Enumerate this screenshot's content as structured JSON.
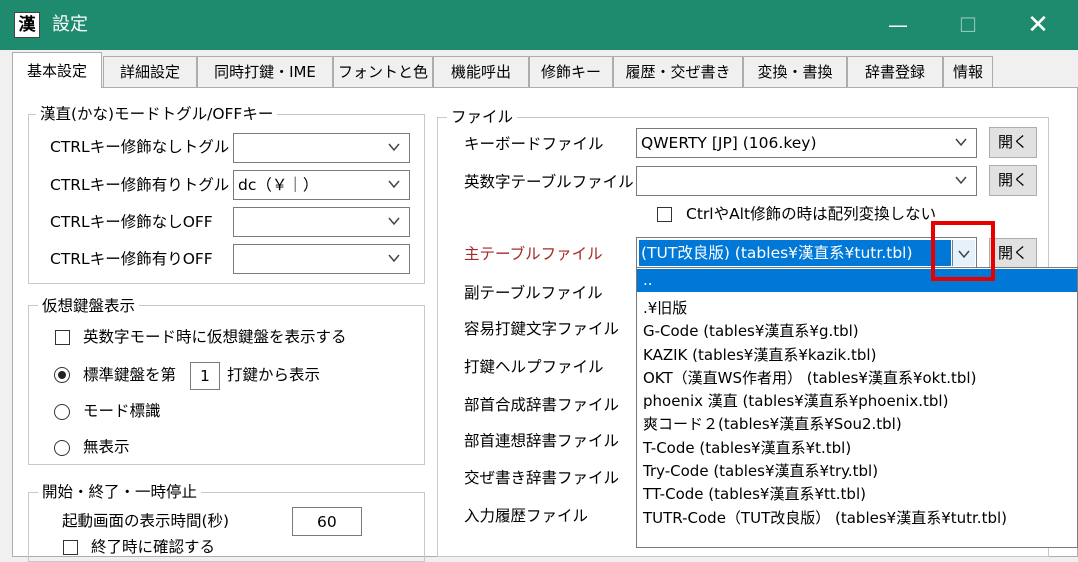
{
  "window": {
    "title": "設定",
    "icon_glyph": "漢",
    "min_glyph": "—",
    "max_glyph": "☐",
    "close_glyph": "✕"
  },
  "tabs": [
    "基本設定",
    "詳細設定",
    "同時打鍵・IME",
    "フォントと色",
    "機能呼出",
    "修飾キー",
    "履歴・交ぜ書き",
    "変換・書換",
    "辞書登録",
    "情報"
  ],
  "active_tab": 0,
  "toggle_group": {
    "legend": "漢直(かな)モードトグル/OFFキー",
    "rows": [
      {
        "label": "CTRLキー修飾なしトグル",
        "value": ""
      },
      {
        "label": "CTRLキー修飾有りトグル",
        "value": "dc（￥｜）"
      },
      {
        "label": "CTRLキー修飾なしOFF",
        "value": ""
      },
      {
        "label": "CTRLキー修飾有りOFF",
        "value": ""
      }
    ]
  },
  "vkb_group": {
    "legend": "仮想鍵盤表示",
    "checkbox_label": "英数字モード時に仮想鍵盤を表示する",
    "radio_standard_prefix": "標準鍵盤を第",
    "radio_standard_value": "1",
    "radio_standard_suffix": "打鍵から表示",
    "radio_mode": "モード標識",
    "radio_none": "無表示"
  },
  "start_group": {
    "legend": "開始・終了・一時停止",
    "splash_label": "起動画面の表示時間(秒)",
    "splash_value": "60",
    "confirm_label": "終了時に確認する"
  },
  "file_group": {
    "legend": "ファイル",
    "keyboard_label": "キーボードファイル",
    "keyboard_value": "QWERTY [JP] (106.key)",
    "alnum_label": "英数字テーブルファイル",
    "alnum_value": "",
    "ctrl_alt_label": "CtrlやAlt修飾の時は配列変換しない",
    "main_table_label": "主テーブルファイル",
    "main_table_value": "(TUT改良版) (tables¥漢直系¥tutr.tbl)",
    "sub_table_label": "副テーブルファイル",
    "easy_label": "容易打鍵文字ファイル",
    "help_label": "打鍵ヘルプファイル",
    "bushu_comp_label": "部首合成辞書ファイル",
    "bushu_assoc_label": "部首連想辞書ファイル",
    "mazegaki_label": "交ぜ書き辞書ファイル",
    "history_label": "入力履歴ファイル",
    "open_label": "開く"
  },
  "dropdown_items": [
    "..",
    ".¥旧版",
    "G-Code (tables¥漢直系¥g.tbl)",
    "KAZIK (tables¥漢直系¥kazik.tbl)",
    "OKT（漢直WS作者用） (tables¥漢直系¥okt.tbl)",
    "phoenix 漢直 (tables¥漢直系¥phoenix.tbl)",
    "爽コード２(tables¥漢直系¥Sou2.tbl)",
    "T-Code (tables¥漢直系¥t.tbl)",
    "Try-Code (tables¥漢直系¥try.tbl)",
    "TT-Code (tables¥漢直系¥tt.tbl)",
    "TUTR-Code（TUT改良版） (tables¥漢直系¥tutr.tbl)"
  ],
  "colors": {
    "titlebar": "#1e8a6e",
    "selection": "#0078d7",
    "highlight": "#e60000",
    "main_label": "#a52a2a"
  }
}
